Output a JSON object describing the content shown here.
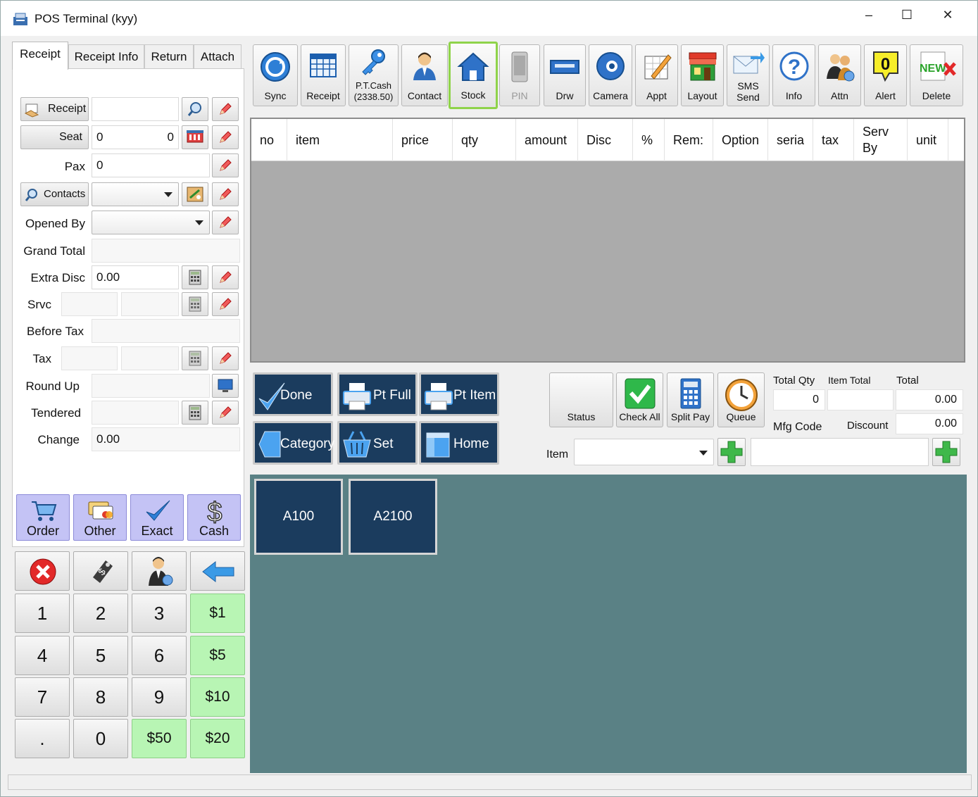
{
  "window": {
    "title": "POS Terminal (kyy)",
    "controls": [
      "–",
      "☐",
      "✕"
    ]
  },
  "tabs": [
    "Receipt",
    "Receipt Info",
    "Return",
    "Attach"
  ],
  "form": {
    "receipt_btn": "Receipt",
    "receipt_value": "",
    "seat_btn": "Seat",
    "seat_value_left": "0",
    "seat_value_right": "0",
    "pax_label": "Pax",
    "pax_value": "0",
    "contacts_btn": "Contacts",
    "opened_by_label": "Opened By",
    "grand_total_label": "Grand Total",
    "extra_disc_label": "Extra Disc",
    "extra_disc_value": "0.00",
    "srvc_label": "Srvc",
    "before_tax_label": "Before Tax",
    "tax_label": "Tax",
    "round_up_label": "Round Up",
    "tendered_label": "Tendered",
    "change_label": "Change",
    "change_value": "0.00"
  },
  "pay_buttons": [
    "Order",
    "Other",
    "Exact",
    "Cash"
  ],
  "keypad": [
    [
      "1",
      "2",
      "3",
      "$1"
    ],
    [
      "4",
      "5",
      "6",
      "$5"
    ],
    [
      "7",
      "8",
      "9",
      "$10"
    ],
    [
      ".",
      "0",
      "$50",
      "$20"
    ]
  ],
  "toolbar": [
    {
      "label": "Sync",
      "icon": "sync-icon"
    },
    {
      "label": "Receipt",
      "icon": "receipt-grid-icon"
    },
    {
      "label": "P.T.Cash\n(2338.50)",
      "icon": "key-icon"
    },
    {
      "label": "Contact",
      "icon": "person-icon"
    },
    {
      "label": "Stock",
      "icon": "house-icon"
    },
    {
      "label": "PIN",
      "icon": "phone-icon"
    },
    {
      "label": "Drw",
      "icon": "drawer-icon"
    },
    {
      "label": "Camera",
      "icon": "camera-icon"
    },
    {
      "label": "Appt",
      "icon": "calendar-pen-icon"
    },
    {
      "label": "Layout",
      "icon": "store-icon"
    },
    {
      "label": "SMS\nSend",
      "icon": "mail-icon"
    },
    {
      "label": "Info",
      "icon": "question-icon"
    },
    {
      "label": "Attn",
      "icon": "people-icon"
    },
    {
      "label": "Alert",
      "icon": "alert-icon",
      "badge": "0"
    },
    {
      "label": "Delete",
      "icon": "new-delete-icon"
    }
  ],
  "grid_columns": [
    "no",
    "item",
    "price",
    "qty",
    "amount",
    "Disc",
    "%",
    "Rem:",
    "Option",
    "seria",
    "tax",
    "Serv By",
    "unit"
  ],
  "actions": [
    "Done",
    "Pt Full",
    "Pt Item",
    "Category",
    "Set",
    "Home"
  ],
  "status_buttons": [
    "Status",
    "Check All",
    "Split Pay",
    "Queue"
  ],
  "totals": {
    "total_qty_label": "Total Qty",
    "item_total_label": "Item Total",
    "total_label": "Total",
    "total_qty_value": "0",
    "item_total_value": "",
    "total_value": "0.00",
    "mfg_code_label": "Mfg Code",
    "discount_label": "Discount",
    "discount_value": "0.00"
  },
  "item_label": "Item",
  "categories": [
    "A100",
    "A2100"
  ],
  "colors": {
    "accent_selected": "#8fd34a",
    "dark_button": "#1b3c5e",
    "category_area": "#5a8185",
    "pay_button": "#c4c3f5",
    "green_key": "#b8f5b4"
  }
}
